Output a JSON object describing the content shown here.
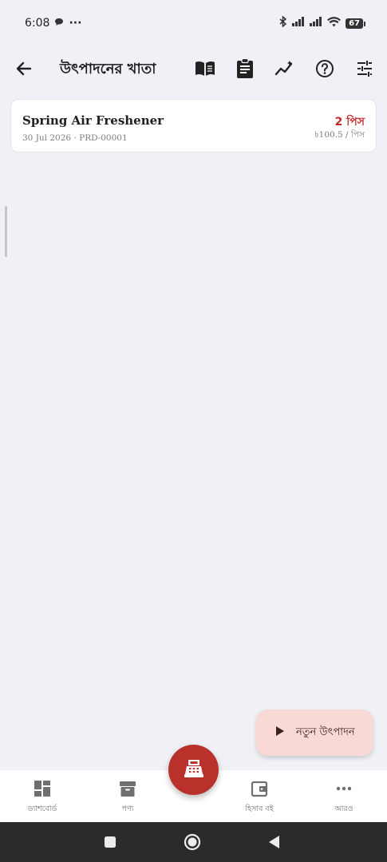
{
  "status_bar": {
    "time": "6:08",
    "more": "···",
    "battery": "67"
  },
  "app_bar": {
    "title": "উৎপাদনের খাতা"
  },
  "production_list": [
    {
      "name": "Spring Air Freshener",
      "date": "30 Jul 2026",
      "separator": "·",
      "code": "PRD-00001",
      "quantity": "2 পিস",
      "rate": "৳100.5 / পিস"
    }
  ],
  "fab": {
    "new_production_label": "নতুন উৎপাদন"
  },
  "bottom_nav": {
    "items": [
      {
        "label": "ড্যাশবোর্ড",
        "icon": "dashboard-icon"
      },
      {
        "label": "পণ্য",
        "icon": "inventory-box-icon"
      },
      {
        "label": "হিসাব বই",
        "icon": "wallet-icon"
      },
      {
        "label": "আরও",
        "icon": "more-horiz-icon"
      }
    ],
    "center_icon": "cash-register-icon"
  },
  "colors": {
    "accent": "#c62828",
    "fab_center": "#b8312b",
    "fab_new_bg": "#f8d9d6",
    "background": "#f0f1f6"
  }
}
